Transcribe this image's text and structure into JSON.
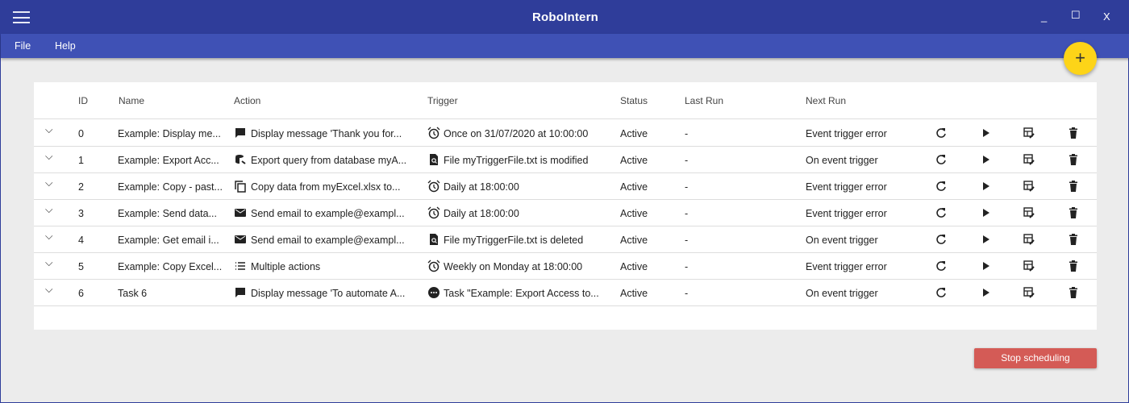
{
  "app": {
    "title": "RoboIntern",
    "minimize": "_",
    "maximize": "☐",
    "close": "X"
  },
  "menu": {
    "file": "File",
    "help": "Help"
  },
  "fab_label": "+",
  "columns": {
    "id": "ID",
    "name": "Name",
    "action": "Action",
    "trigger": "Trigger",
    "status": "Status",
    "last_run": "Last Run",
    "next_run": "Next Run"
  },
  "rows": [
    {
      "id": "0",
      "name": "Example: Display me...",
      "action_icon": "message-icon",
      "action": "Display message 'Thank you for...",
      "trigger_icon": "alarm-icon",
      "trigger": "Once on 31/07/2020 at 10:00:00",
      "status": "Active",
      "last_run": "-",
      "next_run": "Event trigger error"
    },
    {
      "id": "1",
      "name": "Example: Export Acc...",
      "action_icon": "database-export-icon",
      "action": "Export query from database myA...",
      "trigger_icon": "file-search-icon",
      "trigger": "File myTriggerFile.txt is modified",
      "status": "Active",
      "last_run": "-",
      "next_run": "On event trigger"
    },
    {
      "id": "2",
      "name": "Example: Copy - past...",
      "action_icon": "copy-icon",
      "action": "Copy data from myExcel.xlsx to...",
      "trigger_icon": "alarm-icon",
      "trigger": "Daily at 18:00:00",
      "status": "Active",
      "last_run": "-",
      "next_run": "Event trigger error"
    },
    {
      "id": "3",
      "name": "Example: Send data...",
      "action_icon": "email-icon",
      "action": "Send email to example@exampl...",
      "trigger_icon": "alarm-icon",
      "trigger": "Daily at 18:00:00",
      "status": "Active",
      "last_run": "-",
      "next_run": "Event trigger error"
    },
    {
      "id": "4",
      "name": "Example: Get email i...",
      "action_icon": "email-icon",
      "action": "Send email to example@exampl...",
      "trigger_icon": "file-search-icon",
      "trigger": "File myTriggerFile.txt is deleted",
      "status": "Active",
      "last_run": "-",
      "next_run": "On event trigger"
    },
    {
      "id": "5",
      "name": "Example: Copy Excel...",
      "action_icon": "list-icon",
      "action": "Multiple actions",
      "trigger_icon": "alarm-icon",
      "trigger": "Weekly on Monday at 18:00:00",
      "status": "Active",
      "last_run": "-",
      "next_run": "Event trigger error"
    },
    {
      "id": "6",
      "name": "Task 6",
      "action_icon": "message-icon",
      "action": "Display message 'To automate A...",
      "trigger_icon": "task-icon",
      "trigger": "Task \"Example: Export Access to...",
      "status": "Active",
      "last_run": "-",
      "next_run": "On event trigger"
    }
  ],
  "stop_button": "Stop scheduling"
}
